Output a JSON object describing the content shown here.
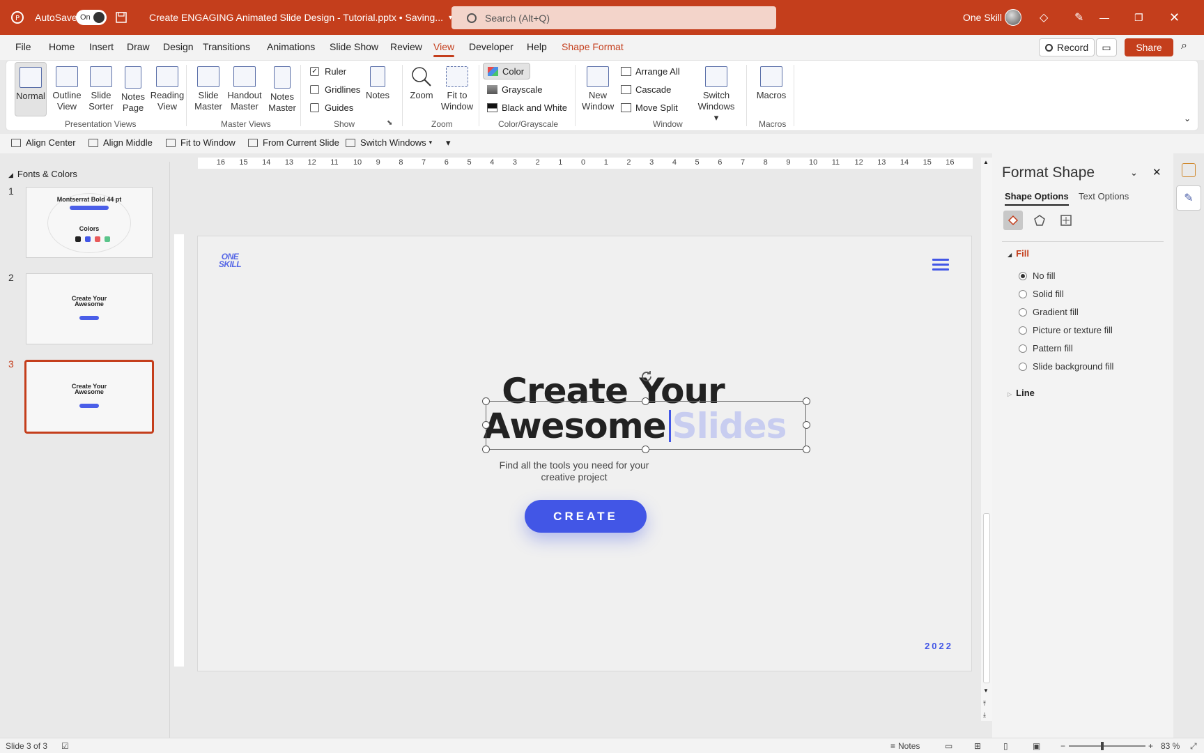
{
  "titlebar": {
    "autosave_label": "AutoSave",
    "autosave_state": "On",
    "doc_title": "Create ENGAGING Animated Slide Design - Tutorial.pptx • Saving...",
    "search_placeholder": "Search (Alt+Q)",
    "user_name": "One Skill",
    "accent_color": "#c43e1c"
  },
  "menu": {
    "items": [
      "File",
      "Home",
      "Insert",
      "Draw",
      "Design",
      "Transitions",
      "Animations",
      "Slide Show",
      "Review",
      "View",
      "Developer",
      "Help",
      "Shape Format"
    ],
    "active": "View",
    "record_label": "Record",
    "share_label": "Share"
  },
  "ribbon": {
    "presentation_views": {
      "label": "Presentation Views",
      "items": [
        "Normal",
        "Outline View",
        "Slide Sorter",
        "Notes Page",
        "Reading View"
      ]
    },
    "master_views": {
      "label": "Master Views",
      "items": [
        "Slide Master",
        "Handout Master",
        "Notes Master"
      ]
    },
    "show": {
      "label": "Show",
      "ruler": "Ruler",
      "gridlines": "Gridlines",
      "guides": "Guides",
      "notes": "Notes"
    },
    "zoom": {
      "label": "Zoom",
      "zoom": "Zoom",
      "fit": "Fit to Window"
    },
    "colorgray": {
      "label": "Color/Grayscale",
      "color": "Color",
      "grayscale": "Grayscale",
      "bw": "Black and White"
    },
    "window": {
      "label": "Window",
      "new_window": "New Window",
      "arrange_all": "Arrange All",
      "cascade": "Cascade",
      "move_split": "Move Split",
      "switch_windows": "Switch Windows"
    },
    "macros": {
      "label": "Macros",
      "macros": "Macros"
    }
  },
  "qat": {
    "align_center": "Align Center",
    "align_middle": "Align Middle",
    "fit_to_window": "Fit to Window",
    "from_current_slide": "From Current Slide",
    "switch_windows": "Switch Windows"
  },
  "thumbs": {
    "section": "Fonts & Colors",
    "slides": [
      {
        "num": "1",
        "title": "Montserrat Bold 44 pt",
        "sub": "Colors"
      },
      {
        "num": "2",
        "title": "Create Your",
        "title2": "Awesome"
      },
      {
        "num": "3",
        "title": "Create Your",
        "title2": "Awesome"
      }
    ]
  },
  "ruler": {
    "ticks": [
      "16",
      "15",
      "14",
      "13",
      "12",
      "11",
      "10",
      "9",
      "8",
      "7",
      "6",
      "5",
      "4",
      "3",
      "2",
      "1",
      "0",
      "1",
      "2",
      "3",
      "4",
      "5",
      "6",
      "7",
      "8",
      "9",
      "10",
      "11",
      "12",
      "13",
      "14",
      "15",
      "16"
    ]
  },
  "slide": {
    "logo_line1": "ONE",
    "logo_line2": "SKILL",
    "line1": "Create Your",
    "line2_word": "Awesome",
    "line2_faint": "Slides",
    "subtitle_line1": "Find all the tools you need for your",
    "subtitle_line2": "creative project",
    "cta": "CREATE",
    "year": "2022",
    "brand_color": "#4256e6"
  },
  "format_pane": {
    "title": "Format Shape",
    "tab_shape": "Shape Options",
    "tab_text": "Text Options",
    "fill_label": "Fill",
    "fill_options": [
      "No fill",
      "Solid fill",
      "Gradient fill",
      "Picture or texture fill",
      "Pattern fill",
      "Slide background fill"
    ],
    "selected_fill": "No fill",
    "line_label": "Line"
  },
  "status": {
    "slide_info": "Slide 3 of 3",
    "notes": "Notes",
    "zoom": "83 %"
  }
}
